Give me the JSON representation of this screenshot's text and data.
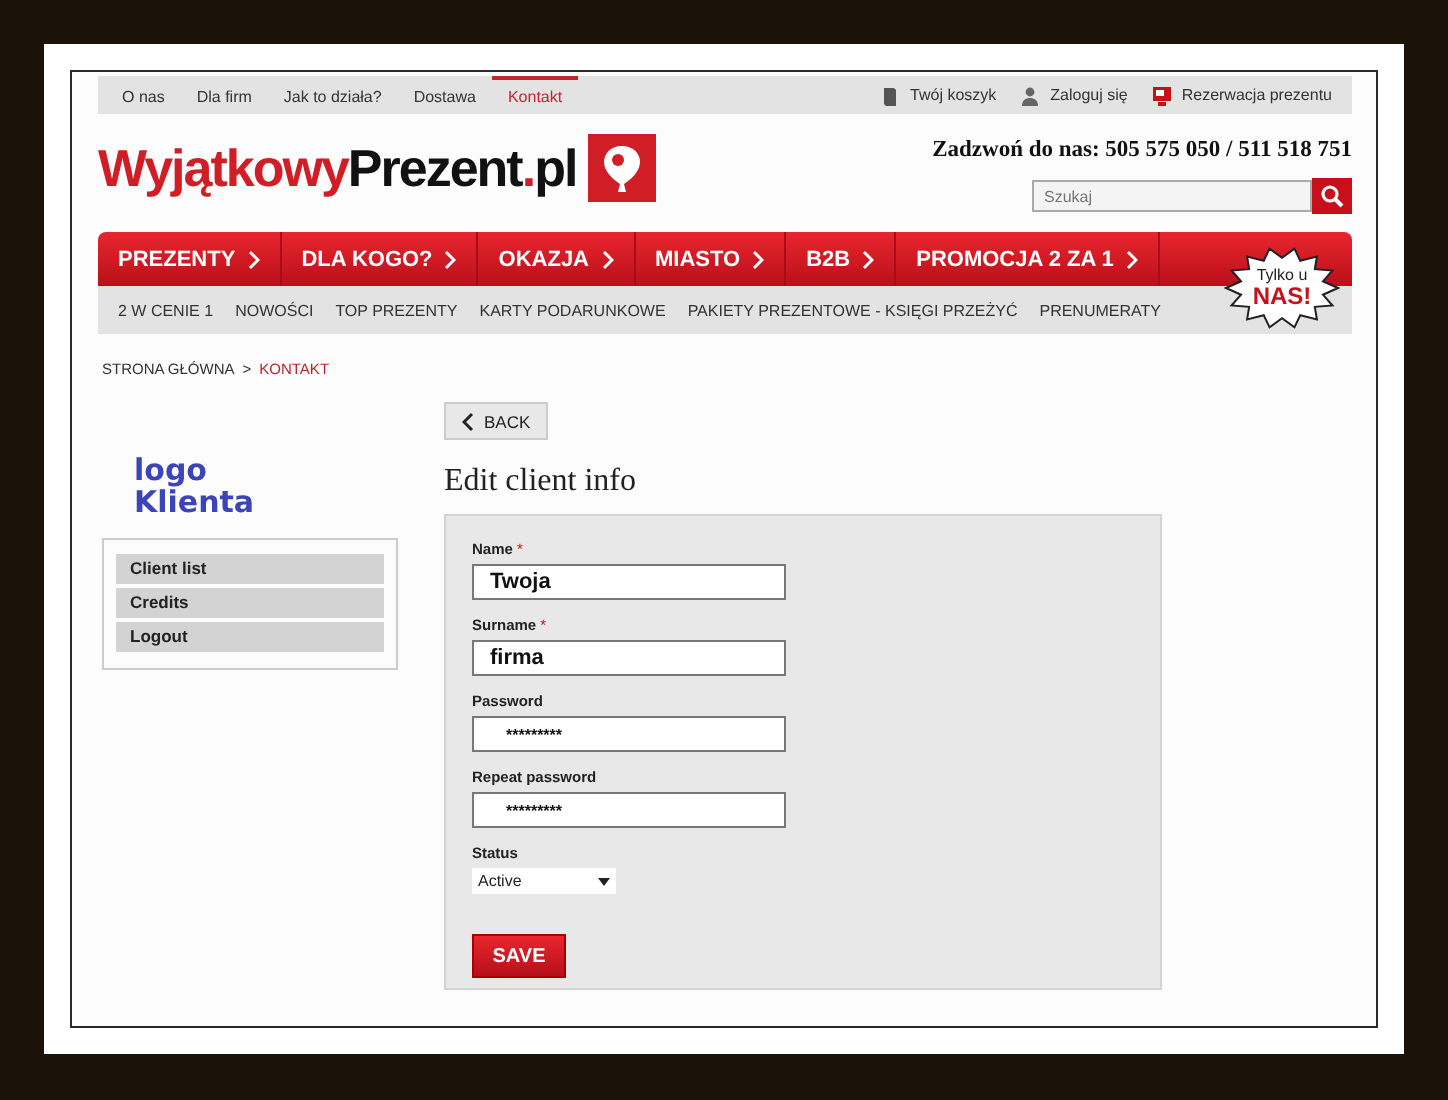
{
  "top_links": [
    {
      "label": "O nas",
      "selected": false
    },
    {
      "label": "Dla firm",
      "selected": false
    },
    {
      "label": "Jak to działa?",
      "selected": false
    },
    {
      "label": "Dostawa",
      "selected": false
    },
    {
      "label": "Kontakt",
      "selected": true
    }
  ],
  "top_actions": [
    {
      "label": "Twój koszyk",
      "kind": "cart"
    },
    {
      "label": "Zaloguj się",
      "kind": "user"
    },
    {
      "label": "Rezerwacja prezentu",
      "kind": "gift"
    }
  ],
  "logo": {
    "first": "Wyjątkowy",
    "second": "Prezent",
    "dot": ".",
    "tld": "pl"
  },
  "phone": "Zadzwoń do nas: 505 575 050 / 511 518 751",
  "search": {
    "placeholder": "Szukaj"
  },
  "nav": [
    "PREZENTY",
    "DLA KOGO?",
    "OKAZJA",
    "MIASTO",
    "B2B",
    "PROMOCJA 2 ZA 1"
  ],
  "badge": {
    "line1": "Tylko u",
    "line2": "NAS!"
  },
  "subnav": [
    "2 W CENIE 1",
    "NOWOŚCI",
    "TOP PREZENTY",
    "KARTY PODARUNKOWE",
    "PAKIETY PREZENTOWE - KSIĘGI PRZEŻYĆ",
    "PRENUMERATY"
  ],
  "breadcrumb": {
    "items": [
      {
        "label": "STRONA GŁÓWNA",
        "selected": false
      },
      {
        "label": "KONTAKT",
        "selected": true
      }
    ],
    "separator": ">"
  },
  "client_logo": [
    "logo",
    "Klienta"
  ],
  "sidebar": {
    "items": [
      "Client list",
      "Credits",
      "Logout"
    ]
  },
  "back_button": "BACK",
  "title": "Edit client info",
  "form": {
    "fields": [
      {
        "label": "Name",
        "required_mark": "*",
        "value": "Twoja",
        "kind": "text"
      },
      {
        "label": "Surname",
        "required_mark": "*",
        "value": "firma",
        "kind": "text"
      },
      {
        "label": "Password",
        "value": "*********",
        "kind": "secret"
      },
      {
        "label": "Repeat password",
        "value": "*********",
        "kind": "secret"
      }
    ],
    "status": {
      "label": "Status",
      "value": "Active"
    },
    "save": "SAVE"
  }
}
